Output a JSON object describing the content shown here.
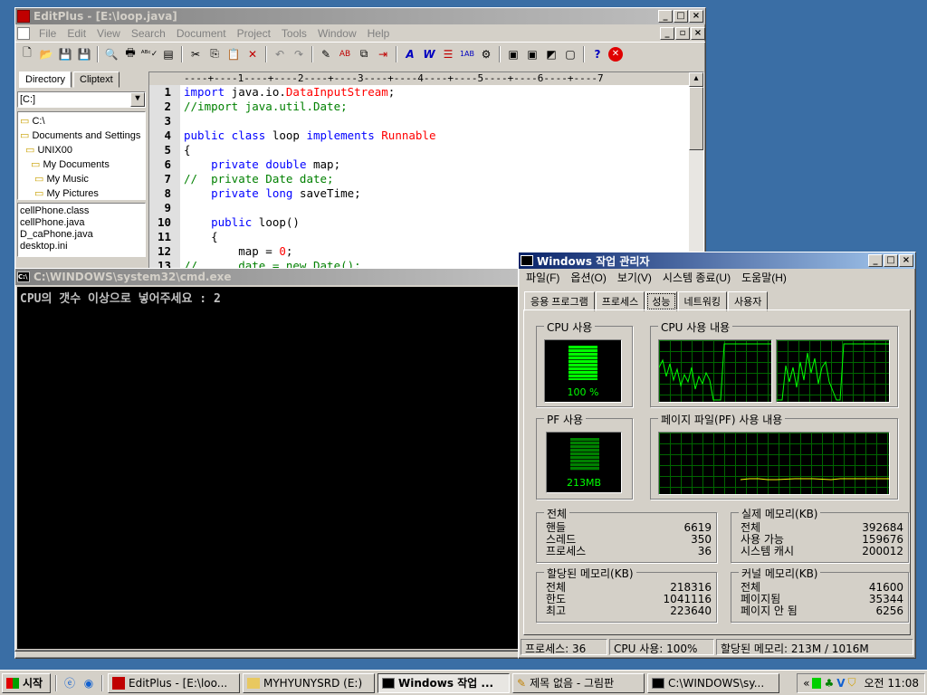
{
  "editplus": {
    "title": "EditPlus - [E:\\loop.java]",
    "menu": [
      "File",
      "Edit",
      "View",
      "Search",
      "Document",
      "Project",
      "Tools",
      "Window",
      "Help"
    ],
    "tabs": [
      "Directory",
      "Cliptext"
    ],
    "drive": "[C:]",
    "tree": [
      "C:\\",
      "Documents and Settings",
      "UNIX00",
      "My Documents",
      "My Music",
      "My Pictures"
    ],
    "files": [
      "cellPhone.class",
      "cellPhone.java",
      "D_caPhone.java",
      "desktop.ini"
    ],
    "ruler": "----+----1----+----2----+----3----+----4----+----5----+----6----+----7",
    "line_numbers": [
      "1",
      "2",
      "3",
      "4",
      "5",
      "6",
      "7",
      "8",
      "9",
      "10",
      "11",
      "12",
      "13"
    ]
  },
  "cmd": {
    "title": "C:\\WINDOWS\\system32\\cmd.exe",
    "output": "CPU의 갯수 이상으로 넣어주세요 : 2"
  },
  "taskmgr": {
    "title": "Windows 작업 관리자",
    "menu": [
      "파일(F)",
      "옵션(O)",
      "보기(V)",
      "시스템 종료(U)",
      "도움말(H)"
    ],
    "tabs": [
      "응용 프로그램",
      "프로세스",
      "성능",
      "네트워킹",
      "사용자"
    ],
    "cpu_usage_label": "CPU 사용",
    "cpu_history_label": "CPU 사용 내용",
    "cpu_value": "100 %",
    "pf_usage_label": "PF 사용",
    "pf_history_label": "페이지 파일(PF) 사용 내용",
    "pf_value": "213MB",
    "totals": {
      "label": "전체",
      "rows": [
        {
          "k": "핸들",
          "v": "6619"
        },
        {
          "k": "스레드",
          "v": "350"
        },
        {
          "k": "프로세스",
          "v": "36"
        }
      ]
    },
    "physical": {
      "label": "실제 메모리(KB)",
      "rows": [
        {
          "k": "전체",
          "v": "392684"
        },
        {
          "k": "사용 가능",
          "v": "159676"
        },
        {
          "k": "시스템 캐시",
          "v": "200012"
        }
      ]
    },
    "commit": {
      "label": "할당된 메모리(KB)",
      "rows": [
        {
          "k": "전체",
          "v": "218316"
        },
        {
          "k": "한도",
          "v": "1041116"
        },
        {
          "k": "최고",
          "v": "223640"
        }
      ]
    },
    "kernel": {
      "label": "커널 메모리(KB)",
      "rows": [
        {
          "k": "전체",
          "v": "41600"
        },
        {
          "k": "페이지됨",
          "v": "35344"
        },
        {
          "k": "페이지 안 됨",
          "v": "6256"
        }
      ]
    },
    "status": [
      "프로세스: 36",
      "CPU 사용: 100%",
      "할당된 메모리: 213M / 1016M"
    ]
  },
  "taskbar": {
    "start": "시작",
    "buttons": [
      "EditPlus - [E:\\loo...",
      "MYHYUNYSRD (E:)",
      "Windows 작업 ...",
      "제목 없음 - 그림판",
      "C:\\WINDOWS\\sy..."
    ],
    "clock": "오전 11:08",
    "tray_expand": "«"
  },
  "colors": {
    "title_active": "#0a246a",
    "desktop": "#3a6ea5",
    "meter_green": "#00ff00",
    "keyword": "#0000ff",
    "classname": "#ff0000",
    "comment": "#008000"
  }
}
